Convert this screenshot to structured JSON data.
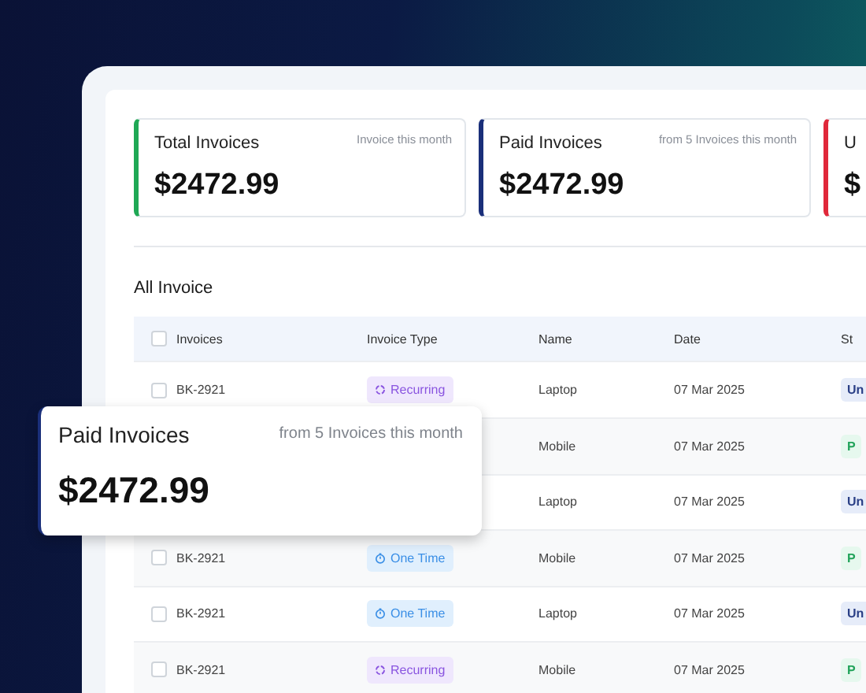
{
  "stat_cards": [
    {
      "title": "Total Invoices",
      "note": "Invoice this month",
      "value": "$2472.99",
      "color": "#1fa855"
    },
    {
      "title": "Paid Invoices",
      "note": "from 5 Invoices this month",
      "value": "$2472.99",
      "color": "#1a2f7a"
    },
    {
      "title": "U",
      "value": "$",
      "color": "#e0283a"
    }
  ],
  "section_title": "All Invoice",
  "table": {
    "header_checked": false,
    "columns": [
      "Invoices",
      "Invoice Type",
      "Name",
      "Date",
      "St"
    ],
    "rows": [
      {
        "checked": false,
        "invoice": "BK-2921",
        "type": {
          "kind": "recurring",
          "label": "Recurring"
        },
        "name": "Laptop",
        "date": "07 Mar 2025",
        "status": {
          "kind": "unpaid",
          "label": "Un"
        }
      },
      {
        "type": null,
        "name": "Mobile",
        "date": "07 Mar 2025",
        "status": {
          "kind": "paid",
          "label": "P"
        }
      },
      {
        "type": null,
        "name": "Laptop",
        "date": "07 Mar 2025",
        "status": {
          "kind": "unpaid",
          "label": "Un"
        }
      },
      {
        "checked": false,
        "invoice": "BK-2921",
        "type": {
          "kind": "one_time",
          "label": "One Time"
        },
        "name": "Mobile",
        "date": "07 Mar 2025",
        "status": {
          "kind": "paid",
          "label": "P"
        }
      },
      {
        "checked": false,
        "invoice": "BK-2921",
        "type": {
          "kind": "one_time",
          "label": "One Time"
        },
        "name": "Laptop",
        "date": "07 Mar 2025",
        "status": {
          "kind": "unpaid",
          "label": "Un"
        }
      },
      {
        "checked": false,
        "invoice": "BK-2921",
        "type": {
          "kind": "recurring",
          "label": "Recurring"
        },
        "name": "Mobile",
        "date": "07 Mar 2025",
        "status": {
          "kind": "paid",
          "label": "P"
        }
      }
    ]
  },
  "popup_card": {
    "title": "Paid Invoices",
    "note": "from 5 Invoices this month",
    "value": "$2472.99",
    "color": "#1a2f7a"
  }
}
